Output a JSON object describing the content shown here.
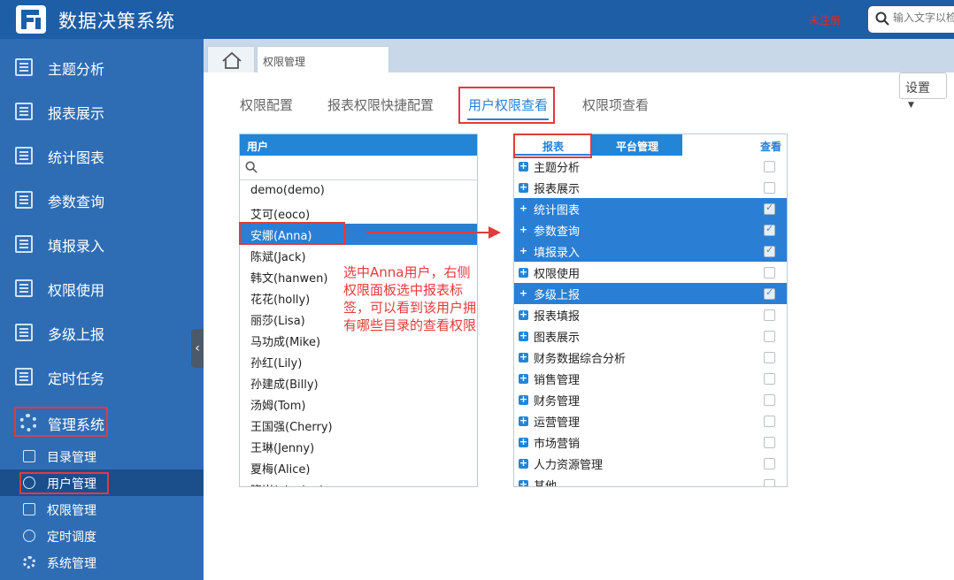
{
  "header": {
    "title": "数据决策系统",
    "register": "未注册",
    "search_placeholder": "输入文字以检"
  },
  "sidebar": {
    "items": [
      {
        "label": "主题分析"
      },
      {
        "label": "报表展示"
      },
      {
        "label": "统计图表"
      },
      {
        "label": "参数查询"
      },
      {
        "label": "填报录入"
      },
      {
        "label": "权限使用"
      },
      {
        "label": "多级上报"
      },
      {
        "label": "定时任务"
      }
    ],
    "admin_label": "管理系统",
    "sub_items": [
      {
        "label": "目录管理"
      },
      {
        "label": "用户管理"
      },
      {
        "label": "权限管理"
      },
      {
        "label": "定时调度"
      },
      {
        "label": "系统管理"
      }
    ]
  },
  "tabs": {
    "page_tab": "权限管理"
  },
  "settings_label": "设置",
  "subtabs": [
    "权限配置",
    "报表权限快捷配置",
    "用户权限查看",
    "权限项查看"
  ],
  "user_panel": {
    "header": "用户",
    "users": [
      "demo(demo)",
      "艾可(eoco)",
      "安娜(Anna)",
      "陈斌(Jack)",
      "韩文(hanwen)",
      "花花(holly)",
      "丽莎(Lisa)",
      "马功成(Mike)",
      "孙红(Lily)",
      "孙建成(Billy)",
      "汤姆(Tom)",
      "王国强(Cherry)",
      "王琳(Jenny)",
      "夏梅(Alice)",
      "晓岚(xiaolan)"
    ],
    "selected_index": 2
  },
  "annotation": "选中Anna用户，右侧权限面板选中报表标签，可以看到该用户拥有哪些目录的查看权限",
  "perm_panel": {
    "tabs": [
      "报表",
      "平台管理",
      "查看"
    ],
    "rows": [
      {
        "label": "主题分析",
        "checked": false,
        "selected": false
      },
      {
        "label": "报表展示",
        "checked": false,
        "selected": false
      },
      {
        "label": "统计图表",
        "checked": true,
        "selected": true
      },
      {
        "label": "参数查询",
        "checked": true,
        "selected": true
      },
      {
        "label": "填报录入",
        "checked": true,
        "selected": true
      },
      {
        "label": "权限使用",
        "checked": false,
        "selected": false
      },
      {
        "label": "多级上报",
        "checked": true,
        "selected": true
      },
      {
        "label": "报表填报",
        "checked": false,
        "selected": false
      },
      {
        "label": "图表展示",
        "checked": false,
        "selected": false
      },
      {
        "label": "财务数据综合分析",
        "checked": false,
        "selected": false
      },
      {
        "label": "销售管理",
        "checked": false,
        "selected": false
      },
      {
        "label": "财务管理",
        "checked": false,
        "selected": false
      },
      {
        "label": "运营管理",
        "checked": false,
        "selected": false
      },
      {
        "label": "市场营销",
        "checked": false,
        "selected": false
      },
      {
        "label": "人力资源管理",
        "checked": false,
        "selected": false
      },
      {
        "label": "其他",
        "checked": false,
        "selected": false
      }
    ]
  }
}
